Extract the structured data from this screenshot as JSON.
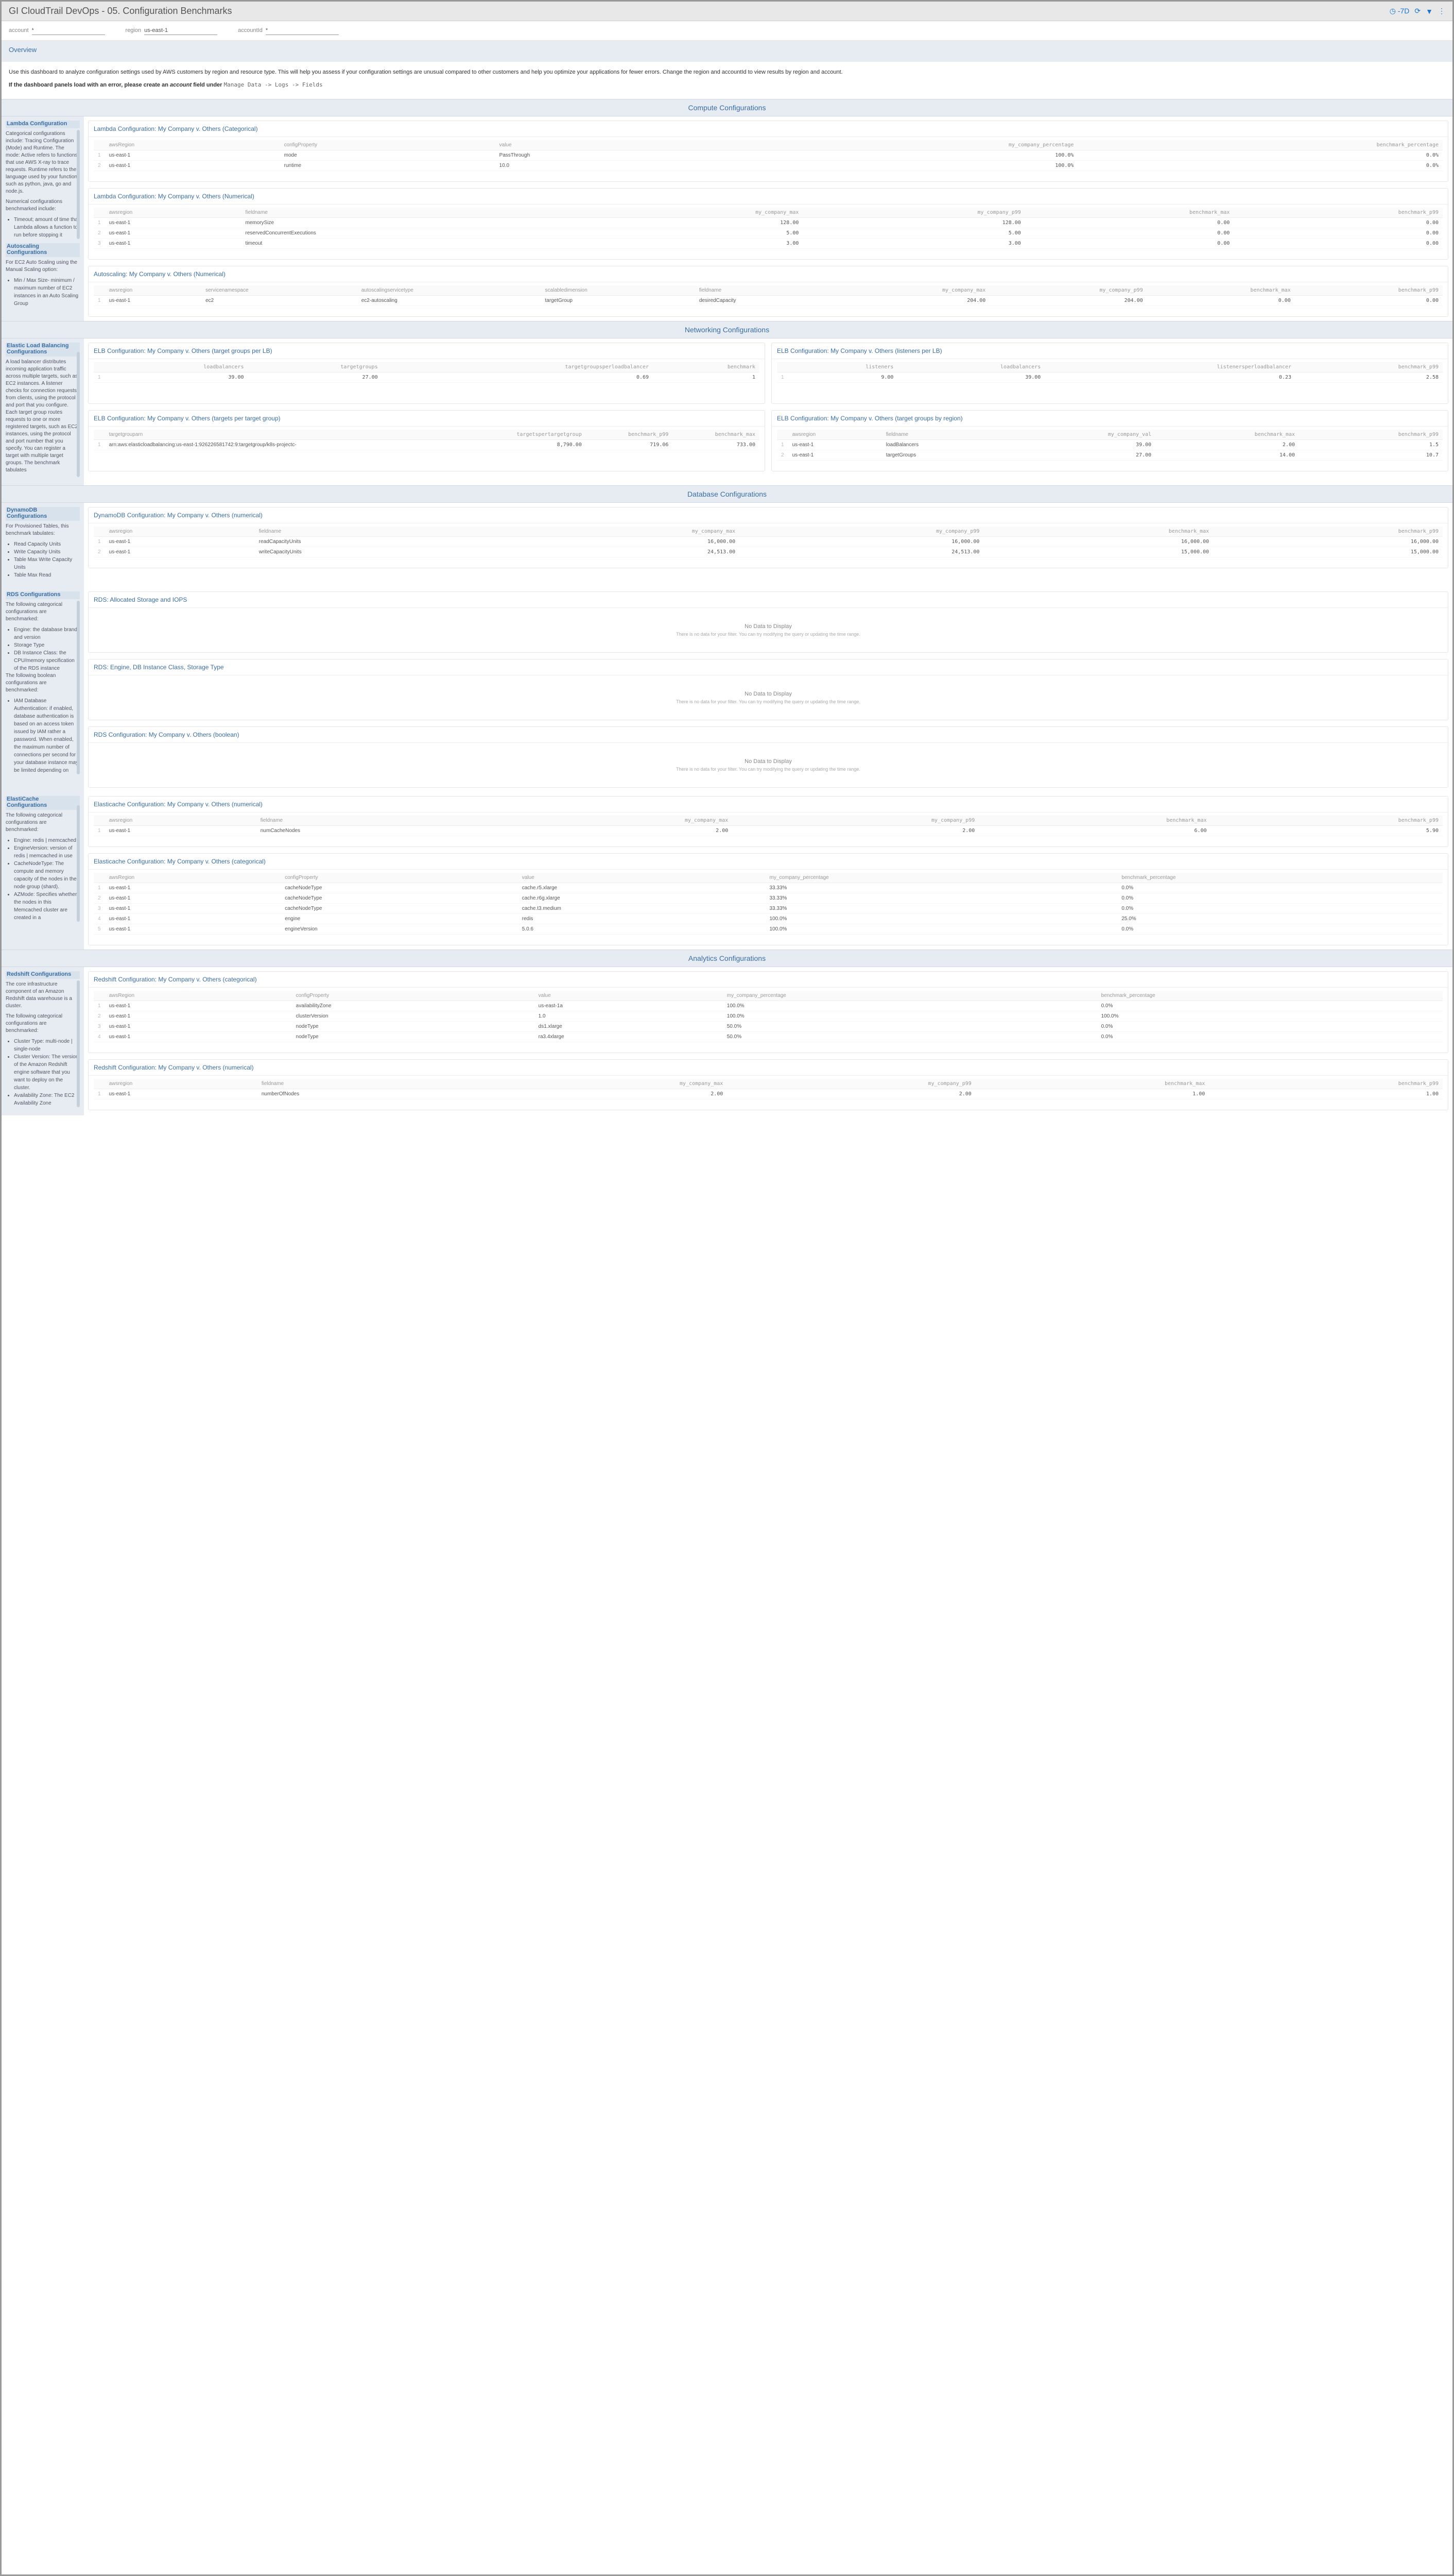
{
  "header": {
    "title": "GI CloudTrail DevOps - 05. Configuration Benchmarks",
    "timeBadge": "-7D"
  },
  "filters": {
    "account": {
      "label": "account",
      "value": "*"
    },
    "region": {
      "label": "region",
      "value": "us-east-1"
    },
    "accountId": {
      "label": "accountId",
      "value": "*"
    }
  },
  "overview": {
    "title": "Overview",
    "p1": "Use this dashboard to analyze configuration settings used by AWS customers by region and resource type. This will help you assess if your configuration settings are unusual compared to other customers and help you optimize your applications for fewer errors. Change the region and accountId to view results by region and account.",
    "p2_prefix": "If the dashboard panels load with an error, please create an ",
    "p2_italic": "account",
    "p2_suffix": " field under  ",
    "p2_mono": "Manage Data -> Logs -> Fields"
  },
  "sections": {
    "compute": "Compute Configurations",
    "networking": "Networking Configurations",
    "database": "Database Configurations",
    "analytics": "Analytics Configurations"
  },
  "sidebars": {
    "lambda": {
      "title": "Lambda Configuration",
      "p1": "Categorical configurations include: Tracing Configuration (Mode) and Runtime. The mode: Active refers to functions that use AWS X-ray to trace requests. Runtime refers to the language used by your functions such as python, java, go and node.js.",
      "p2": "Numerical configurations benchmarked include:",
      "items": [
        "Timeout; amount of time that Lambda allows a function to run before stopping it"
      ]
    },
    "autoscaling": {
      "title": "Autoscaling Configurations",
      "p1": "For EC2 Auto Scaling using the Manual Scaling option:",
      "items": [
        "Min / Max Size- minimum / maximum number of EC2 instances in an Auto Scaling Group"
      ]
    },
    "elb": {
      "title": "Elastic Load Balancing Configurations",
      "p1": "A load balancer distributes incoming application traffic across multiple targets, such as EC2 instances. A listener checks for connection requests from clients, using the protocol and port that you configure. Each target group routes requests to one or more registered targets, such as EC2 instances, using the protocol and port number that you specify. You can register a target with multiple target groups. The benchmark tabulates"
    },
    "dynamo": {
      "title": "DynamoDB Configurations",
      "p1": "For Provisioned Tables, this benchmark tabulates:",
      "items": [
        "Read Capacity Units",
        "Write Capacity Units",
        "Table Max Write Capacity Units",
        "Table Max Read"
      ]
    },
    "rds": {
      "title": "RDS Configurations",
      "p1": "The following categorical configurations are benchmarked:",
      "items1": [
        "Engine: the database brand and version",
        "Storage Type",
        "DB Instance Class: the CPU/memory specification of the RDS instance"
      ],
      "p2": "The following boolean configurations are benchmarked:",
      "items2": [
        "IAM Database Authentication: if enabled, database authentication is based on an access token issued by IAM rather a password. When enabled, the maximum number of connections per second for your database instance may be limited depending on"
      ]
    },
    "elasticache": {
      "title": "ElastiCache Configurations",
      "p1": "The following categorical configurations are benchmarked:",
      "items": [
        "Engine: redis | memcached",
        "EngineVersion: version of redis | memcached in use",
        "CacheNodeType: The compute and memory capacity of the nodes in the node group (shard).",
        "AZMode: Specifies whether the nodes in this Memcached cluster are created in a"
      ]
    },
    "redshift": {
      "title": "Redshift Configurations",
      "p1": "The core infrastructure component of an Amazon Redshift data warehouse is a cluster.",
      "p2": "The following categorical configurations are benchmarked:",
      "items": [
        "Cluster Type: multi-node | single-node",
        "Cluster Version: The version of the Amazon Redshift engine software that you want to deploy on the cluster.",
        "Availability Zone: The EC2 Availability Zone"
      ]
    }
  },
  "panels": {
    "lambdaCat": {
      "title": "Lambda Configuration: My Company v. Others (Categorical)",
      "cols": [
        "awsRegion",
        "configProperty",
        "value",
        "my_company_percentage",
        "benchmark_percentage"
      ],
      "rows": [
        [
          "us-east-1",
          "mode",
          "PassThrough",
          "100.0%",
          "0.0%"
        ],
        [
          "us-east-1",
          "runtime",
          "10.0",
          "100.0%",
          "0.0%"
        ]
      ]
    },
    "lambdaNum": {
      "title": "Lambda Configuration: My Company v. Others (Numerical)",
      "cols": [
        "awsregion",
        "fieldname",
        "my_company_max",
        "my_company_p99",
        "benchmark_max",
        "benchmark_p99"
      ],
      "rows": [
        [
          "us-east-1",
          "memorySize",
          "128.00",
          "128.00",
          "0.00",
          "0.00"
        ],
        [
          "us-east-1",
          "reservedConcurrentExecutions",
          "5.00",
          "5.00",
          "0.00",
          "0.00"
        ],
        [
          "us-east-1",
          "timeout",
          "3.00",
          "3.00",
          "0.00",
          "0.00"
        ]
      ]
    },
    "autoNum": {
      "title": "Autoscaling: My Company v. Others (Numerical)",
      "cols": [
        "awsregion",
        "servicenamespace",
        "autoscalingservicetype",
        "scalabledimension",
        "fieldname",
        "my_company_max",
        "my_company_p99",
        "benchmark_max",
        "benchmark_p99"
      ],
      "rows": [
        [
          "us-east-1",
          "ec2",
          "ec2-autoscaling",
          "targetGroup",
          "desiredCapacity",
          "204.00",
          "204.00",
          "0.00",
          "0.00"
        ]
      ]
    },
    "elbTgPerLb": {
      "title": "ELB Configuration: My Company v. Others (target groups per LB)",
      "cols": [
        "loadbalancers",
        "targetgroups",
        "targetgroupsperloadbalancer",
        "benchmark"
      ],
      "rows": [
        [
          "39.00",
          "27.00",
          "0.69",
          "1"
        ]
      ]
    },
    "elbListeners": {
      "title": "ELB Configuration: My Company v. Others (listeners per LB)",
      "cols": [
        "listeners",
        "loadbalancers",
        "listenersperloadbalancer",
        "benchmark_p99"
      ],
      "rows": [
        [
          "9.00",
          "39.00",
          "0.23",
          "2.58"
        ]
      ]
    },
    "elbTargetsPerTg": {
      "title": "ELB Configuration: My Company v. Others (targets per target group)",
      "cols": [
        "targetgrouparn",
        "targetspertargetgroup",
        "benchmark_p99",
        "benchmark_max"
      ],
      "rows": [
        [
          "arn:aws:elasticloadbalancing:us-east-1:926226581742:9:targetgroup/k8s-projectc-",
          "8,790.00",
          "719.06",
          "733.00"
        ]
      ]
    },
    "elbTgByRegion": {
      "title": "ELB Configuration: My Company v. Others (target groups by region)",
      "cols": [
        "awsregion",
        "fieldname",
        "my_company_val",
        "benchmark_max",
        "benchmark_p99"
      ],
      "rows": [
        [
          "us-east-1",
          "loadBalancers",
          "39.00",
          "2.00",
          "1.5"
        ],
        [
          "us-east-1",
          "targetGroups",
          "27.00",
          "14.00",
          "10.7"
        ]
      ]
    },
    "dynamoNum": {
      "title": "DynamoDB Configuration: My Company v. Others (numerical)",
      "cols": [
        "awsregion",
        "fieldname",
        "my_company_max",
        "my_company_p99",
        "benchmark_max",
        "benchmark_p99"
      ],
      "rows": [
        [
          "us-east-1",
          "readCapacityUnits",
          "16,000.00",
          "16,000.00",
          "16,000.00",
          "16,000.00"
        ],
        [
          "us-east-1",
          "writeCapacityUnits",
          "24,513.00",
          "24,513.00",
          "15,000.00",
          "15,000.00"
        ]
      ]
    },
    "rds1": {
      "title": "RDS: Allocated Storage and IOPS"
    },
    "rds2": {
      "title": "RDS: Engine, DB Instance Class, Storage Type"
    },
    "rds3": {
      "title": "RDS Configuration: My Company v. Others (boolean)"
    },
    "noData": {
      "title": "No Data to Display",
      "sub": "There is no data for your filter. You can try modifying the query or updating the time range."
    },
    "elastiNum": {
      "title": "Elasticache Configuration: My Company v. Others (numerical)",
      "cols": [
        "awsregion",
        "fieldname",
        "my_company_max",
        "my_company_p99",
        "benchmark_max",
        "benchmark_p99"
      ],
      "rows": [
        [
          "us-east-1",
          "numCacheNodes",
          "2.00",
          "2.00",
          "6.00",
          "5.90"
        ]
      ]
    },
    "elastiCat": {
      "title": "Elasticache Configuration: My Company v. Others (categorical)",
      "cols": [
        "awsRegion",
        "configProperty",
        "value",
        "my_company_percentage",
        "benchmark_percentage"
      ],
      "rows": [
        [
          "us-east-1",
          "cacheNodeType",
          "cache.r5.xlarge",
          "33.33%",
          "0.0%"
        ],
        [
          "us-east-1",
          "cacheNodeType",
          "cache.r6g.xlarge",
          "33.33%",
          "0.0%"
        ],
        [
          "us-east-1",
          "cacheNodeType",
          "cache.t3.medium",
          "33.33%",
          "0.0%"
        ],
        [
          "us-east-1",
          "engine",
          "redis",
          "100.0%",
          "25.0%"
        ],
        [
          "us-east-1",
          "engineVersion",
          "5.0.6",
          "100.0%",
          "0.0%"
        ]
      ]
    },
    "redshiftCat": {
      "title": "Redshift Configuration: My Company v. Others (categorical)",
      "cols": [
        "awsRegion",
        "configProperty",
        "value",
        "my_company_percentage",
        "benchmark_percentage"
      ],
      "rows": [
        [
          "us-east-1",
          "availabilityZone",
          "us-east-1a",
          "100.0%",
          "0.0%"
        ],
        [
          "us-east-1",
          "clusterVersion",
          "1.0",
          "100.0%",
          "100.0%"
        ],
        [
          "us-east-1",
          "nodeType",
          "ds1.xlarge",
          "50.0%",
          "0.0%"
        ],
        [
          "us-east-1",
          "nodeType",
          "ra3.4xlarge",
          "50.0%",
          "0.0%"
        ]
      ]
    },
    "redshiftNum": {
      "title": "Redshift Configuration: My Company v. Others (numerical)",
      "cols": [
        "awsregion",
        "fieldname",
        "my_company_max",
        "my_company_p99",
        "benchmark_max",
        "benchmark_p99"
      ],
      "rows": [
        [
          "us-east-1",
          "numberOfNodes",
          "2.00",
          "2.00",
          "1.00",
          "1.00"
        ]
      ]
    }
  }
}
